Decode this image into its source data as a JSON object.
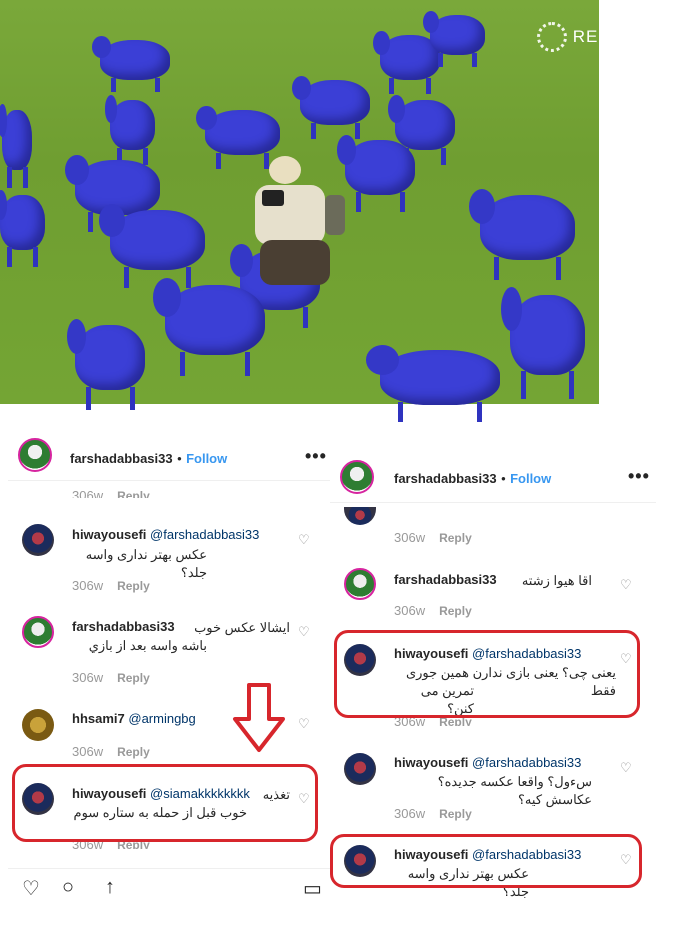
{
  "photo": {
    "watermark": "REUTERS"
  },
  "left_post": {
    "header": {
      "username": "farshadabbasi33",
      "separator": "•",
      "follow": "Follow",
      "more": "•••"
    },
    "partial_meta": {
      "time": "306w",
      "reply": "Reply"
    },
    "comments": [
      {
        "user": "hiwayousefi",
        "mention": "@farshadabbasi33",
        "text": "عکس بهتر نداری واسه جلد؟",
        "time": "306w",
        "reply": "Reply"
      },
      {
        "user": "farshadabbasi33",
        "mention": "",
        "text": "ایشالا عکس خوب",
        "text2": "باشه واسه بعد از بازي",
        "time": "306w",
        "reply": "Reply"
      },
      {
        "user": "hhsami7",
        "mention": "@armingbg",
        "text": "",
        "time": "306w",
        "reply": "Reply"
      },
      {
        "user": "hiwayousefi",
        "mention": "@siamakkkkkkkk",
        "text": "تغذیه",
        "text2": "خوب قبل از حمله به ستاره سوم",
        "time": "306w",
        "reply": "Reply"
      }
    ]
  },
  "right_post": {
    "header": {
      "username": "farshadabbasi33",
      "separator": "•",
      "follow": "Follow",
      "more": "•••"
    },
    "comments": [
      {
        "user": "",
        "mention": "",
        "text": "",
        "time": "306w",
        "reply": "Reply"
      },
      {
        "user": "farshadabbasi33",
        "mention": "",
        "text": "اقا هیوا زشته",
        "time": "306w",
        "reply": "Reply"
      },
      {
        "user": "hiwayousefi",
        "mention": "@farshadabbasi33",
        "text": "یعنی چی؟ یعنی بازی ندارن همین جوری فقط",
        "text2": "تمرین می کنن؟",
        "time": "306w",
        "reply": "Reply"
      },
      {
        "user": "hiwayousefi",
        "mention": "@farshadabbasi33",
        "text": "سءول؟ واقعا عکسه جدیده؟ عکاسش کیه؟",
        "time": "306w",
        "reply": "Reply"
      },
      {
        "user": "hiwayousefi",
        "mention": "@farshadabbasi33",
        "text": "عکس بهتر نداری واسه جلد؟"
      }
    ]
  },
  "colors": {
    "highlight": "#d7262c",
    "follow": "#3897f0",
    "sheep": "#3b3fd6"
  }
}
